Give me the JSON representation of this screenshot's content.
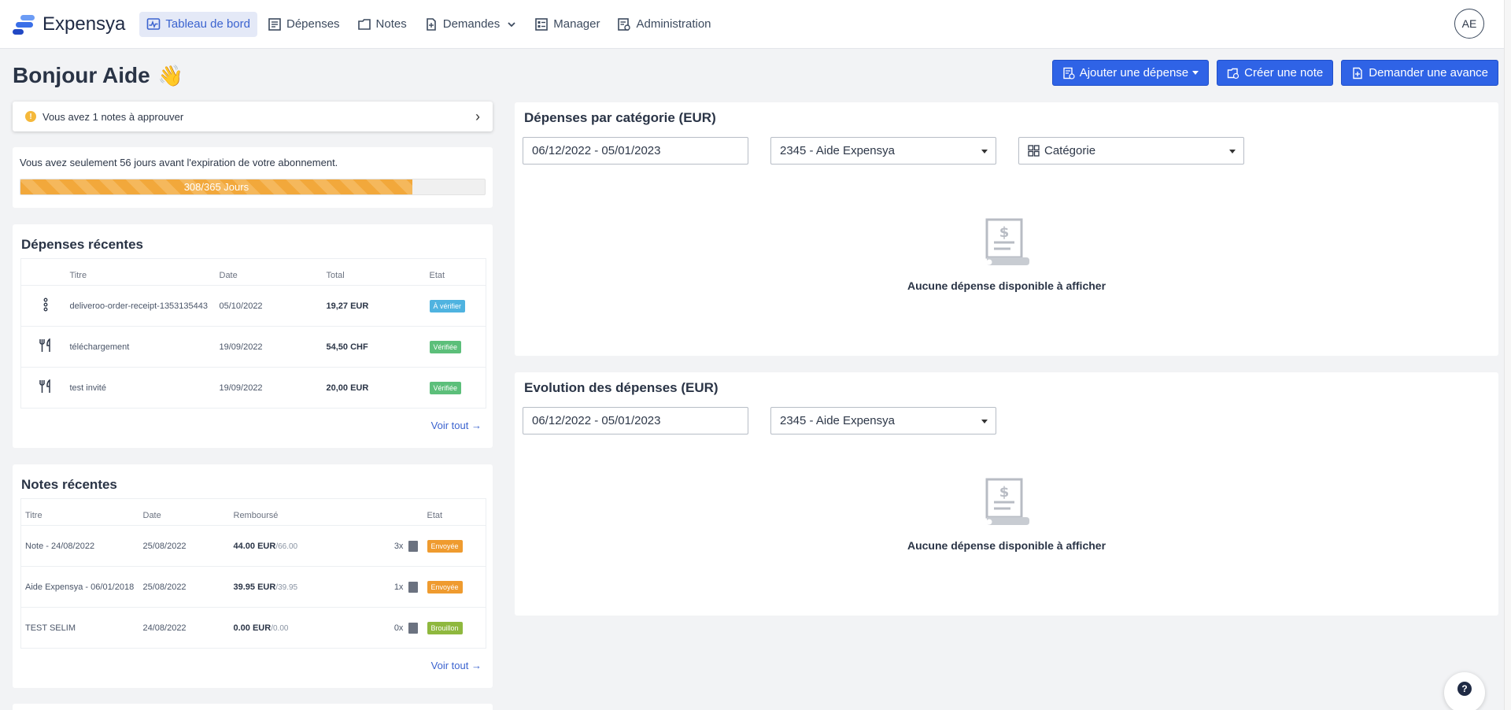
{
  "brand": {
    "name": "Expensya"
  },
  "nav": {
    "items": [
      {
        "label": "Tableau de bord",
        "icon": "dashboard-icon",
        "active": true
      },
      {
        "label": "Dépenses",
        "icon": "receipt-icon"
      },
      {
        "label": "Notes",
        "icon": "folder-icon"
      },
      {
        "label": "Demandes",
        "icon": "request-icon"
      },
      {
        "label": "Manager",
        "icon": "manager-icon"
      },
      {
        "label": "Administration",
        "icon": "admin-icon"
      }
    ],
    "avatar": "AE"
  },
  "header": {
    "greeting": "Bonjour Aide",
    "wave": "👋",
    "actions": {
      "add_expense": "Ajouter une dépense",
      "create_note": "Créer une note",
      "request_advance": "Demander une avance"
    }
  },
  "approval": {
    "text": "Vous avez 1 notes à approuver",
    "count_badge": "!"
  },
  "subscription": {
    "message": "Vous avez seulement 56 jours avant l'expiration de votre abonnement.",
    "progress_label": "308/365 Jours",
    "progress_fraction": 0.8438
  },
  "recent_expenses": {
    "title": "Dépenses récentes",
    "columns": {
      "title": "Titre",
      "date": "Date",
      "total": "Total",
      "state": "Etat"
    },
    "rows": [
      {
        "icon": "more-icon",
        "title": "deliveroo-order-receipt-1353135443",
        "date": "05/10/2022",
        "total": "19,27 EUR",
        "state": "À vérifier",
        "state_color": "#4fb3e0"
      },
      {
        "icon": "restaurant-icon",
        "title": "téléchargement",
        "date": "19/09/2022",
        "total": "54,50 CHF",
        "state": "Vérifiée",
        "state_color": "#5cbf7a"
      },
      {
        "icon": "restaurant-icon",
        "title": "test invité",
        "date": "19/09/2022",
        "total": "20,00 EUR",
        "state": "Vérifiée",
        "state_color": "#5cbf7a"
      }
    ],
    "see_all": "Voir tout"
  },
  "recent_notes": {
    "title": "Notes récentes",
    "columns": {
      "title": "Titre",
      "date": "Date",
      "reimbursed": "Remboursé",
      "state": "Etat"
    },
    "rows": [
      {
        "title": "Note - 24/08/2022",
        "date": "25/08/2022",
        "amount": "44.00 EUR",
        "total": "/66.00",
        "count": "3x",
        "state": "Envoyée",
        "state_color": "#ef9b2f"
      },
      {
        "title": "Aide Expensya - 06/01/2018",
        "date": "25/08/2022",
        "amount": "39.95 EUR",
        "total": "/39.95",
        "count": "1x",
        "state": "Envoyée",
        "state_color": "#ef9b2f"
      },
      {
        "title": "TEST SELIM",
        "date": "24/08/2022",
        "amount": "0.00 EUR",
        "total": "/0.00",
        "count": "0x",
        "state": "Brouillon",
        "state_color": "#8fb83e"
      }
    ],
    "see_all": "Voir tout"
  },
  "category_panel": {
    "title": "Dépenses par catégorie (EUR)",
    "date_range": "06/12/2022 - 05/01/2023",
    "user": "2345 - Aide Expensya",
    "group_by": "Catégorie",
    "empty": "Aucune dépense disponible à afficher"
  },
  "evolution_panel": {
    "title": "Evolution des dépenses (EUR)",
    "date_range": "06/12/2022 - 05/01/2023",
    "user": "2345 - Aide Expensya",
    "empty": "Aucune dépense disponible à afficher"
  },
  "help": {
    "label": "?"
  }
}
